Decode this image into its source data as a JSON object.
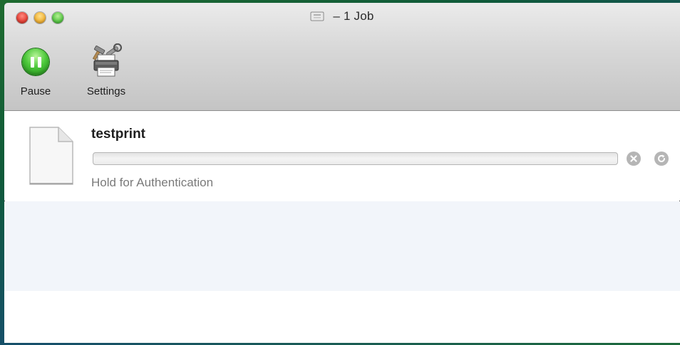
{
  "window": {
    "title": "– 1 Job",
    "title_icon": "printer-icon"
  },
  "toolbar": {
    "pause": {
      "label": "Pause",
      "icon": "pause-icon",
      "color": "#4cc83a"
    },
    "settings": {
      "label": "Settings",
      "icon": "printer-settings-icon"
    }
  },
  "jobs": [
    {
      "name": "testprint",
      "status": "Hold for Authentication",
      "progress": 0,
      "icon": "document-icon",
      "actions": {
        "cancel_icon": "cancel-icon",
        "resume_icon": "resume-icon"
      }
    }
  ],
  "colors": {
    "close": "#e6453a",
    "minimize": "#f2b53a",
    "maximize": "#5ec94b",
    "alt_row": "#f2f5fa"
  }
}
